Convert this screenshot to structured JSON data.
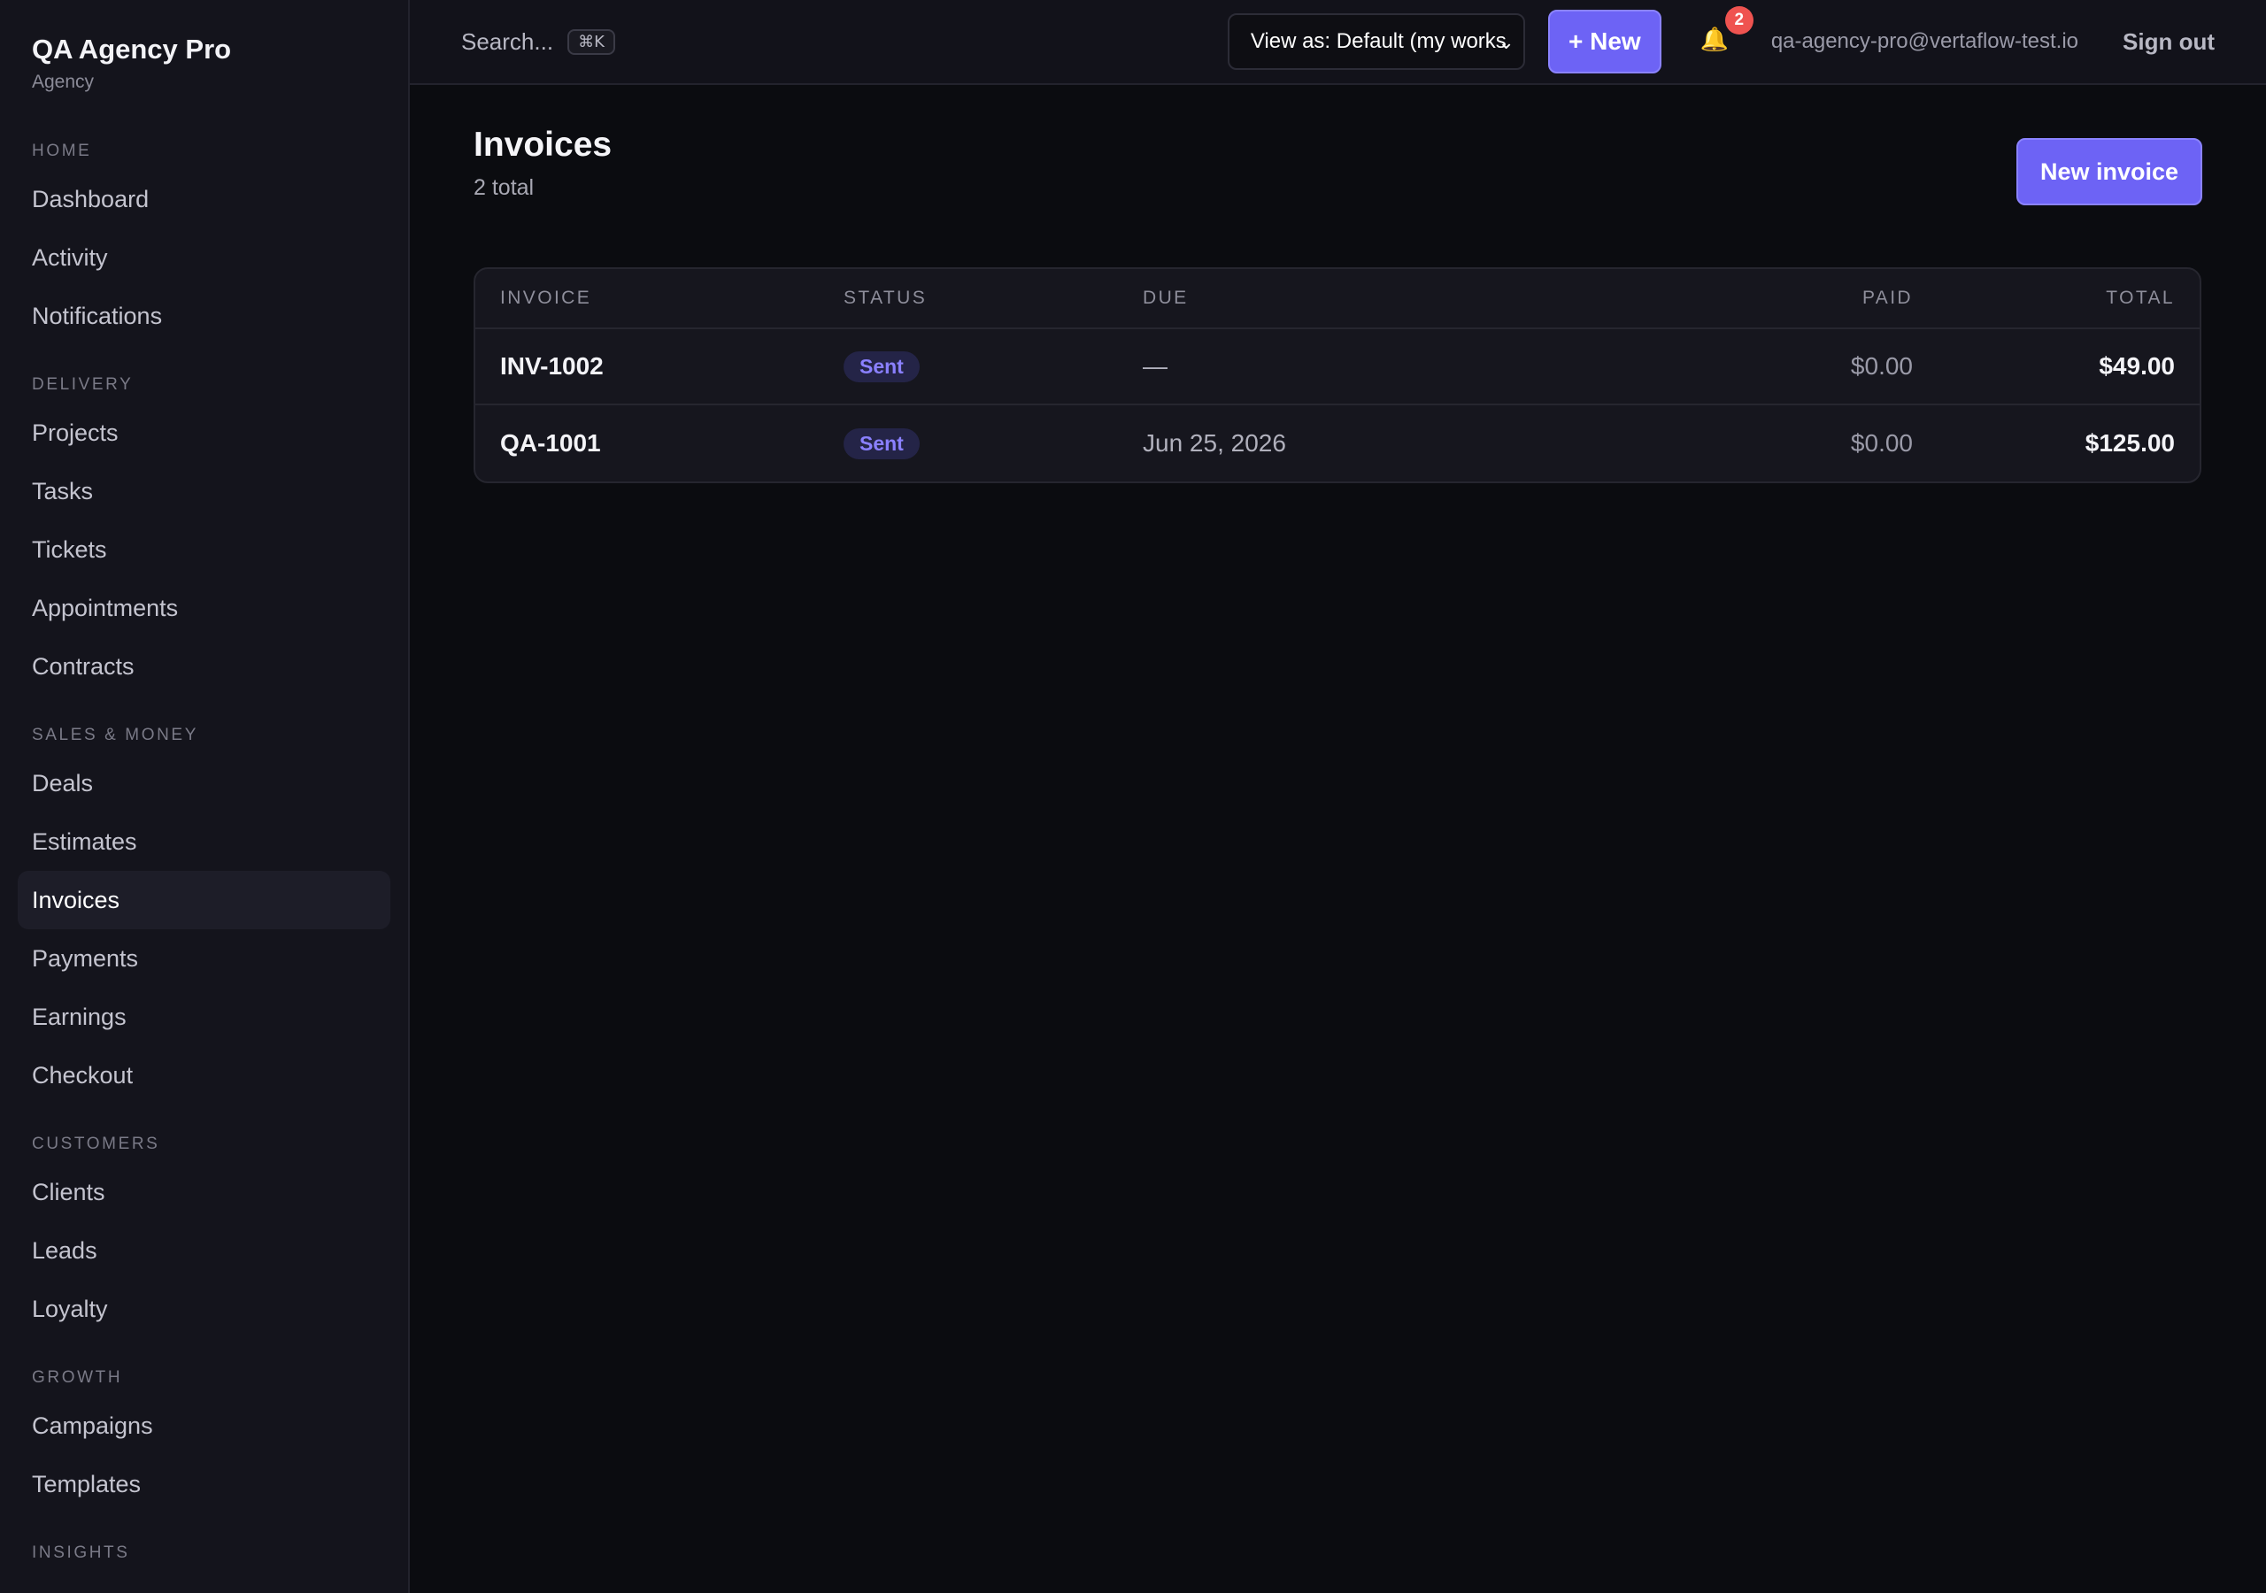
{
  "brand": {
    "name": "QA Agency Pro",
    "subtitle": "Agency"
  },
  "sidebar": {
    "sections": [
      {
        "title": "HOME",
        "items": [
          "Dashboard",
          "Activity",
          "Notifications"
        ]
      },
      {
        "title": "DELIVERY",
        "items": [
          "Projects",
          "Tasks",
          "Tickets",
          "Appointments",
          "Contracts"
        ]
      },
      {
        "title": "SALES & MONEY",
        "items": [
          "Deals",
          "Estimates",
          "Invoices",
          "Payments",
          "Earnings",
          "Checkout"
        ]
      },
      {
        "title": "CUSTOMERS",
        "items": [
          "Clients",
          "Leads",
          "Loyalty"
        ]
      },
      {
        "title": "GROWTH",
        "items": [
          "Campaigns",
          "Templates"
        ]
      },
      {
        "title": "INSIGHTS",
        "items": []
      }
    ],
    "active": "Invoices"
  },
  "topbar": {
    "search_placeholder": "Search...",
    "search_shortcut": "⌘K",
    "view_as": "View as: Default (my works",
    "new_button": "+ New",
    "notification_count": "2",
    "user_email": "qa-agency-pro@vertaflow-test.io",
    "sign_out": "Sign out"
  },
  "page": {
    "title": "Invoices",
    "subtitle": "2 total",
    "new_invoice_button": "New invoice"
  },
  "table": {
    "columns": {
      "invoice": "INVOICE",
      "status": "STATUS",
      "due": "DUE",
      "paid": "PAID",
      "total": "TOTAL"
    },
    "rows": [
      {
        "invoice": "INV-1002",
        "status": "Sent",
        "due": "—",
        "paid": "$0.00",
        "total": "$49.00"
      },
      {
        "invoice": "QA-1001",
        "status": "Sent",
        "due": "Jun 25, 2026",
        "paid": "$0.00",
        "total": "$125.00"
      }
    ]
  },
  "colors": {
    "accent": "#6d63f5",
    "badge_text": "#8a80ff",
    "notification": "#ef5350"
  },
  "icons": {
    "notification": "bell-icon",
    "view_as_chevron": "chevron-down-icon"
  }
}
